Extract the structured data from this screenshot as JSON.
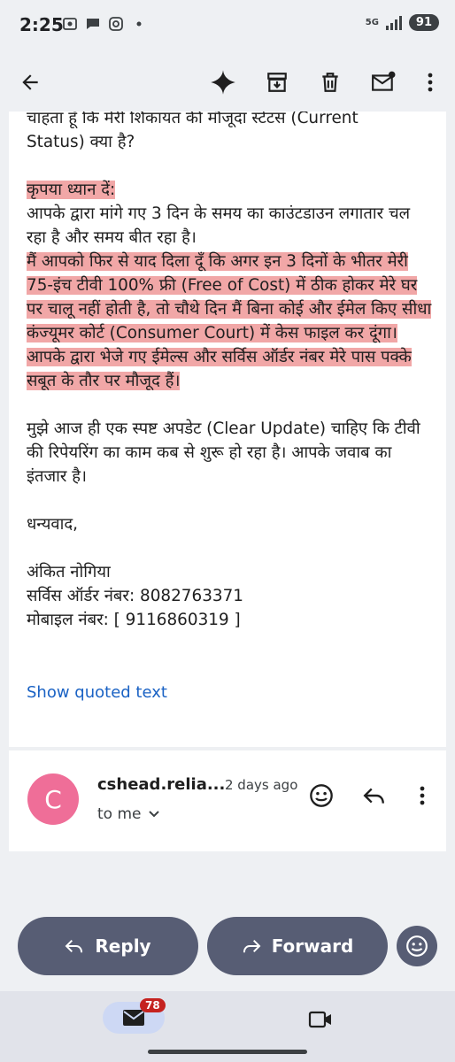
{
  "status_bar": {
    "time": "2:25",
    "network": "5G",
    "battery": "91"
  },
  "toolbar": {
    "back_icon": "arrow-left-icon",
    "actions": [
      "gemini-sparkle-icon",
      "archive-icon",
      "delete-icon",
      "mark-unread-icon",
      "more-vert-icon"
    ]
  },
  "message": {
    "line_top": "चाहता हूँ कि मेरी शिकायत की मौजूदा स्टेटस (Current",
    "line_status": "Status) क्या है?",
    "note_label": "कृपया ध्यान दें:",
    "countdown": "आपके द्वारा मांगे गए 3 दिन के समय का काउंटडाउन लगातार चल रहा है और समय बीत रहा है।",
    "warning": "मैं आपको फिर से याद दिला दूँ कि अगर इन 3 दिनों के भीतर मेरी 75-इंच टीवी 100% फ्री (Free of Cost) में ठीक होकर मेरे घर पर चालू नहीं होती है, तो चौथे दिन मैं बिना कोई और ईमेल किए सीधा कंज्यूमर कोर्ट (Consumer Court) में केस फाइल कर दूंगा। आपके द्वारा भेजे गए ईमेल्स और सर्विस ऑर्डर नंबर मेरे पास पक्के सबूत के तौर पर मौजूद हैं।",
    "update_request": "मुझे आज ही एक स्पष्ट अपडेट (Clear Update) चाहिए कि टीवी की रिपेयरिंग का काम कब से शुरू हो रहा है। आपके जवाब का इंतजार है।",
    "thanks": "धन्यवाद,",
    "name": "अंकित नोगिया",
    "service_order": "सर्विस ऑर्डर नंबर: 8082763371",
    "mobile": "मोबाइल नंबर: [ 9116860319 ]",
    "show_quoted": "Show quoted text"
  },
  "next_message": {
    "avatar_letter": "C",
    "avatar_color": "#ef6e98",
    "sender": "cshead.relia...",
    "date": "2 days ago",
    "recipient": "to me"
  },
  "actions": {
    "reply": "Reply",
    "forward": "Forward"
  },
  "bottom_nav": {
    "mail_badge": "78"
  },
  "colors": {
    "highlight": "#f1a7a7",
    "link": "#1a62c4",
    "pill": "#575d74"
  }
}
